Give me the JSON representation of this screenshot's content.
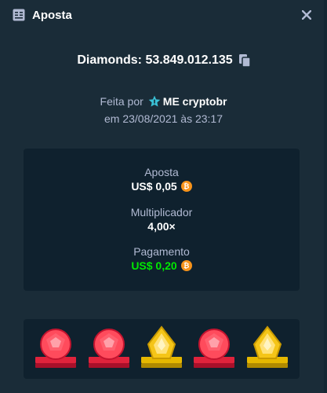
{
  "header": {
    "title": "Aposta",
    "icon": "bet-slip-icon",
    "close_icon": "close-icon"
  },
  "game": {
    "name": "Diamonds",
    "separator": ": ",
    "bet_id": "53.849.012.135"
  },
  "made_by": {
    "prefix": "Feita por",
    "user": "ME cryptobr",
    "badge_icon": "star-icon"
  },
  "date_text": "em 23/08/2021 às 23:17",
  "stats": {
    "bet_label": "Aposta",
    "bet_value": "US$ 0,05",
    "multiplier_label": "Multiplicador",
    "multiplier_value": "4,00×",
    "payout_label": "Pagamento",
    "payout_value": "US$ 0,20",
    "coin_symbol": "₿"
  },
  "colors": {
    "background": "#1a2c38",
    "panel": "#0f212e",
    "muted_text": "#b1bad3",
    "payout_green": "#00e701",
    "bitcoin_orange": "#f7931a",
    "red_gem": "#e0233c",
    "yellow_gem": "#f5c518"
  },
  "gems": [
    "red",
    "red",
    "yellow",
    "red",
    "yellow"
  ]
}
